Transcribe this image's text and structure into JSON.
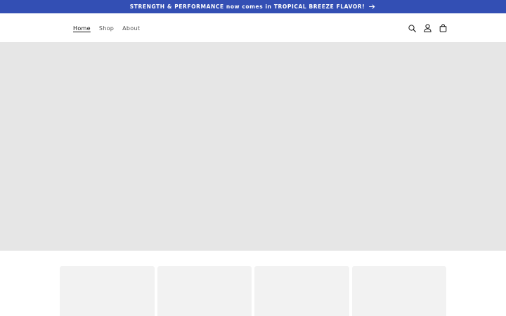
{
  "colors": {
    "announcement_bg": "#334fb4",
    "hero_placeholder": "#e6e6e6",
    "card_placeholder": "#f2f2f2"
  },
  "announcement": {
    "text": "STRENGTH & PERFORMANCE now comes in TROPICAL BREEZE FLAVOR!",
    "icon": "arrow-right-icon"
  },
  "header": {
    "nav": [
      {
        "label": "Home",
        "active": true
      },
      {
        "label": "Shop",
        "active": false
      },
      {
        "label": "About",
        "active": false
      }
    ],
    "icons": [
      "search-icon",
      "account-icon",
      "cart-icon"
    ]
  },
  "hero": {
    "image": "hero-image-placeholder"
  },
  "collections": {
    "cards": [
      {
        "image": "collection-card-placeholder"
      },
      {
        "image": "collection-card-placeholder"
      },
      {
        "image": "collection-card-placeholder"
      },
      {
        "image": "collection-card-placeholder"
      }
    ]
  }
}
